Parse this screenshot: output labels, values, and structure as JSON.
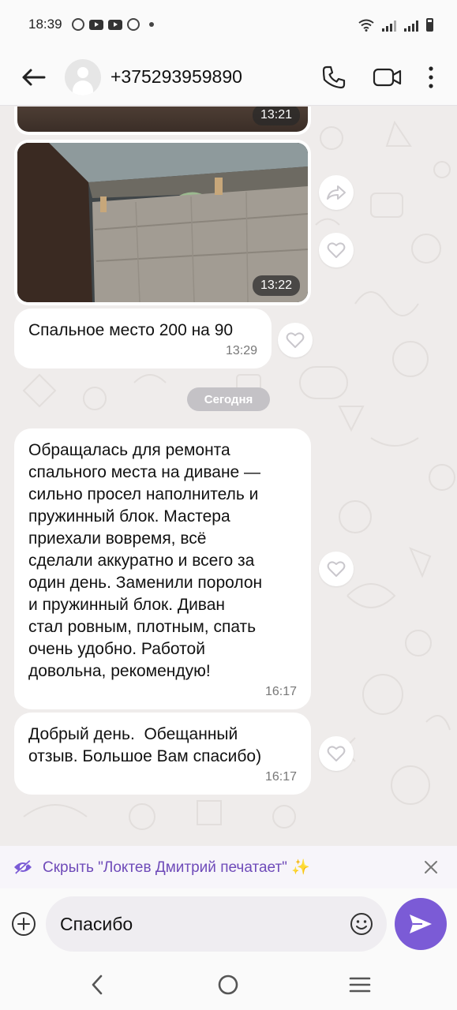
{
  "status_bar": {
    "time": "18:39",
    "notification_icons": [
      "viber-icon",
      "youtube-icon",
      "youtube-icon",
      "viber-icon",
      "dot-icon"
    ],
    "right_icons": [
      "wifi-icon",
      "signal-icon",
      "signal-icon",
      "battery-icon"
    ]
  },
  "header": {
    "contact_name": "+375293959890",
    "icons": [
      "back-arrow-icon",
      "avatar-icon",
      "phone-icon",
      "video-call-icon",
      "more-vertical-icon"
    ]
  },
  "messages": [
    {
      "type": "image",
      "time": "13:21"
    },
    {
      "type": "image",
      "time": "13:22"
    },
    {
      "type": "text",
      "text": "Спальное место 200 на 90",
      "time": "13:29"
    },
    {
      "type": "date",
      "label": "Сегодня"
    },
    {
      "type": "text",
      "text": "Обращалась для ремонта\nспального места на диване —\nсильно просел наполнитель и\nпружинный блок. Мастера\nприехали вовремя, всё\nсделали аккуратно и всего за\nодин день. Заменили поролон\nи пружинный блок. Диван\nстал ровным, плотным, спать\nочень удобно. Работой\nдовольна, рекомендую!",
      "time": "16:17"
    },
    {
      "type": "text",
      "text": "Добрый день.  Обещанный\nотзыв. Большое Вам спасибо)",
      "time": "16:17"
    }
  ],
  "typing_banner": {
    "text": "Скрыть \"Локтев Дмитрий печатает\"",
    "sparkle": "✨",
    "icons": [
      "eye-hidden-icon",
      "close-icon"
    ]
  },
  "composer": {
    "input_value": "Спасибо",
    "icons": [
      "plus-icon",
      "emoji-icon",
      "send-icon"
    ]
  },
  "nav_bar": {
    "icons": [
      "back-nav-icon",
      "home-nav-icon",
      "recents-nav-icon"
    ]
  },
  "colors": {
    "accent": "#7b5bd6",
    "typing_text": "#6f4bb9",
    "chat_background": "#efeceb",
    "bubble": "#ffffff"
  }
}
